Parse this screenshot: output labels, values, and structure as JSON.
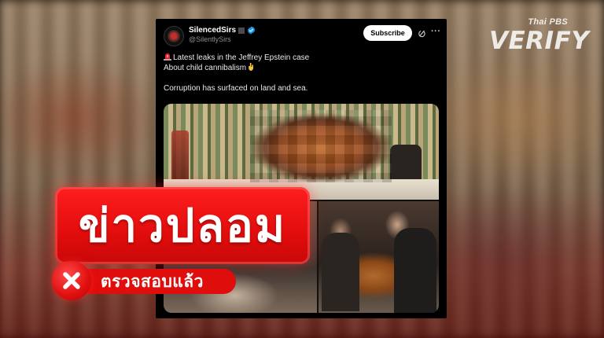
{
  "logo": {
    "small_text": "Thai PBS",
    "big_text": "VERIFY"
  },
  "tweet": {
    "display_name": "SilencedSirs",
    "handle": "@SilentlySirs",
    "subscribe_label": "Subscribe",
    "line1": "Latest leaks in the Jeffrey Epstein case",
    "line2": "About child cannibalism",
    "line3": "Corruption has surfaced on land and sea."
  },
  "overlay": {
    "headline": "ข่าวปลอม",
    "verdict_label": "ตรวจสอบแล้ว"
  },
  "colors": {
    "alert_red": "#e20d0d",
    "card_bg": "#000000",
    "verified_blue": "#1d9bf0"
  },
  "icons": {
    "siren": "police-light-icon",
    "hand": "pointing-down-icon",
    "verified": "verified-badge-icon",
    "grok": "grok-icon",
    "more": "more-icon",
    "cross": "x-mark-icon"
  }
}
